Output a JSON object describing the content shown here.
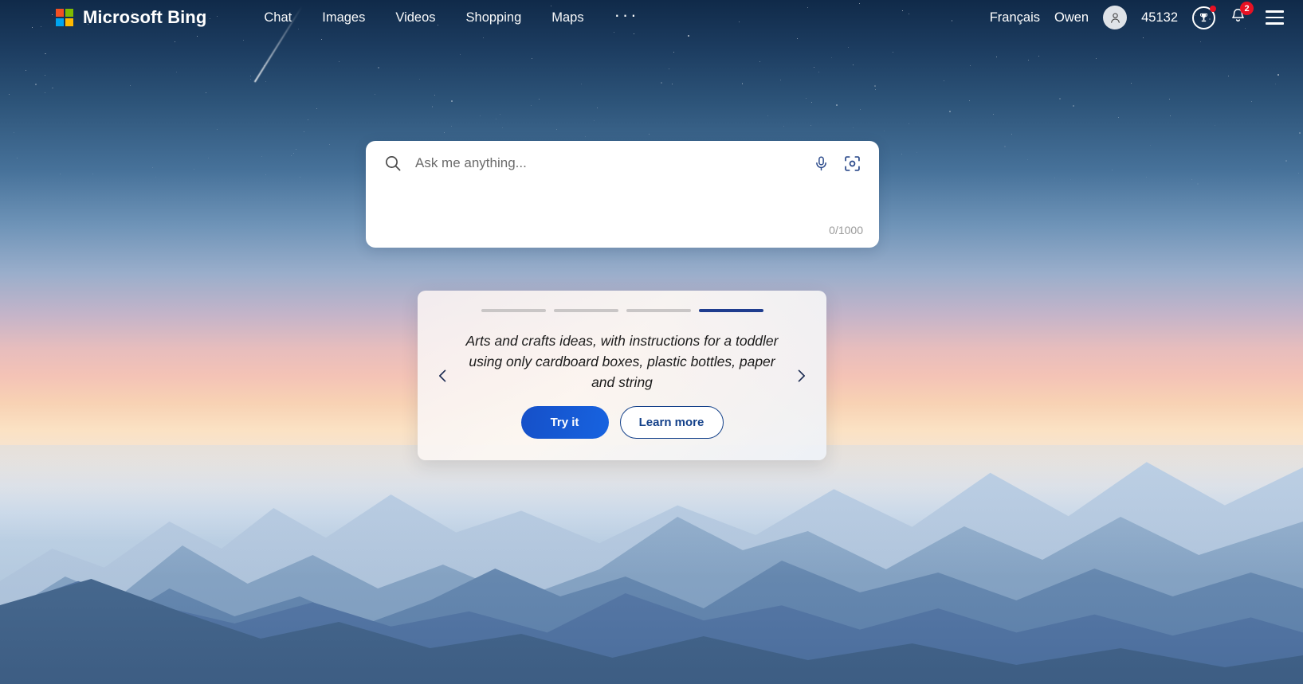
{
  "header": {
    "brand": "Microsoft Bing",
    "logo_icon": "microsoft-logo-icon",
    "nav": [
      {
        "label": "Chat",
        "name": "nav-chat"
      },
      {
        "label": "Images",
        "name": "nav-images"
      },
      {
        "label": "Videos",
        "name": "nav-videos"
      },
      {
        "label": "Shopping",
        "name": "nav-shopping"
      },
      {
        "label": "Maps",
        "name": "nav-maps"
      }
    ],
    "more_label": "···",
    "language": "Français",
    "user_name": "Owen",
    "avatar_icon": "person-icon",
    "rewards_points": "45132",
    "rewards_icon": "rewards-trophy-icon",
    "notifications_icon": "bell-icon",
    "notifications_count": "2",
    "menu_icon": "hamburger-menu-icon"
  },
  "search": {
    "placeholder": "Ask me anything...",
    "value": "",
    "char_count": "0/1000",
    "search_icon": "search-icon",
    "mic_icon": "microphone-icon",
    "visual_search_icon": "visual-search-camera-icon"
  },
  "suggestion_card": {
    "progress": [
      {
        "active": false
      },
      {
        "active": false
      },
      {
        "active": false
      },
      {
        "active": true
      }
    ],
    "prompt": "Arts and crafts ideas, with instructions for a toddler using only cardboard boxes, plastic bottles, paper and string",
    "try_label": "Try it",
    "learn_label": "Learn more",
    "prev_icon": "chevron-left-icon",
    "next_icon": "chevron-right-icon"
  },
  "colors": {
    "accent_blue": "#1763e0",
    "active_bar": "#1f3d8f",
    "badge_red": "#e81123",
    "outline_blue": "#14418a"
  }
}
